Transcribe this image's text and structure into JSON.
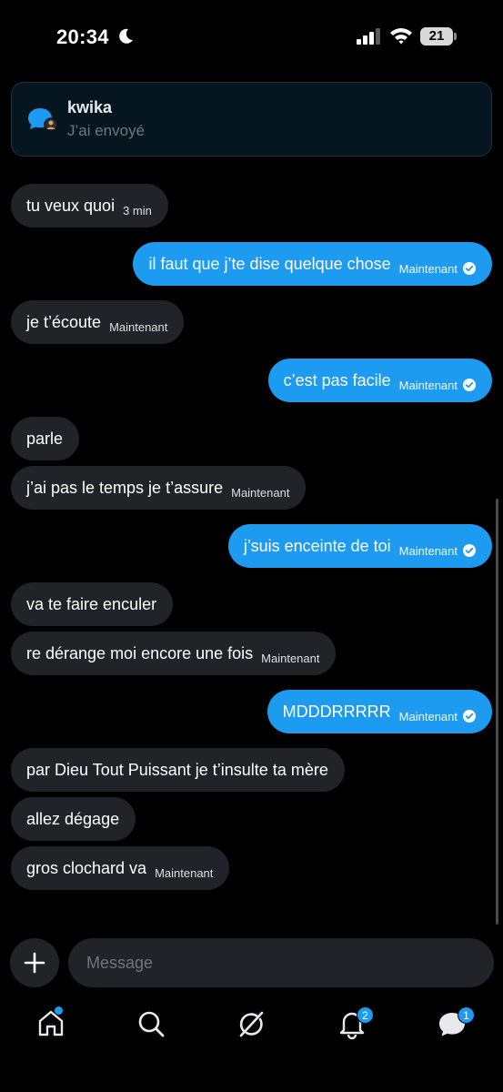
{
  "status_bar": {
    "time": "20:34",
    "battery": "21"
  },
  "notification": {
    "title": "kwika",
    "subtitle": "J’ai envoyé"
  },
  "messages": [
    {
      "direction": "in",
      "text": "tu veux quoi",
      "time": "3 min"
    },
    {
      "direction": "out",
      "text": "il faut que j’te dise quelque chose",
      "time": "Maintenant"
    },
    {
      "direction": "in",
      "text": "je t’écoute",
      "time": "Maintenant"
    },
    {
      "direction": "out",
      "text": "c’est pas facile",
      "time": "Maintenant"
    },
    {
      "direction": "in",
      "text": "parle",
      "time": ""
    },
    {
      "direction": "in",
      "text": "j’ai pas le temps je t’assure",
      "time": "Maintenant"
    },
    {
      "direction": "out",
      "text": "j’suis enceinte de toi",
      "time": "Maintenant"
    },
    {
      "direction": "in",
      "text": "va te faire enculer",
      "time": ""
    },
    {
      "direction": "in",
      "text": "re dérange moi encore une fois",
      "time": "Maintenant"
    },
    {
      "direction": "out",
      "text": "MDDDRRRRR",
      "time": "Maintenant"
    },
    {
      "direction": "in",
      "text": "par Dieu Tout Puissant je t’insulte ta mère",
      "time": ""
    },
    {
      "direction": "in",
      "text": "allez dégage",
      "time": ""
    },
    {
      "direction": "in",
      "text": "gros clochard va",
      "time": "Maintenant"
    }
  ],
  "composer": {
    "placeholder": "Message"
  },
  "nav": {
    "home_icon": "home-icon",
    "search_icon": "search-icon",
    "grok_icon": "grok-icon",
    "notifications_icon": "bell-icon",
    "notifications_count": "2",
    "messages_icon": "messages-icon",
    "messages_count": "1"
  },
  "colors": {
    "background": "#000000",
    "incoming_bubble": "#202327",
    "outgoing_bubble": "#1d9bf0",
    "accent": "#1d9bf0",
    "muted_text": "#71767b"
  }
}
